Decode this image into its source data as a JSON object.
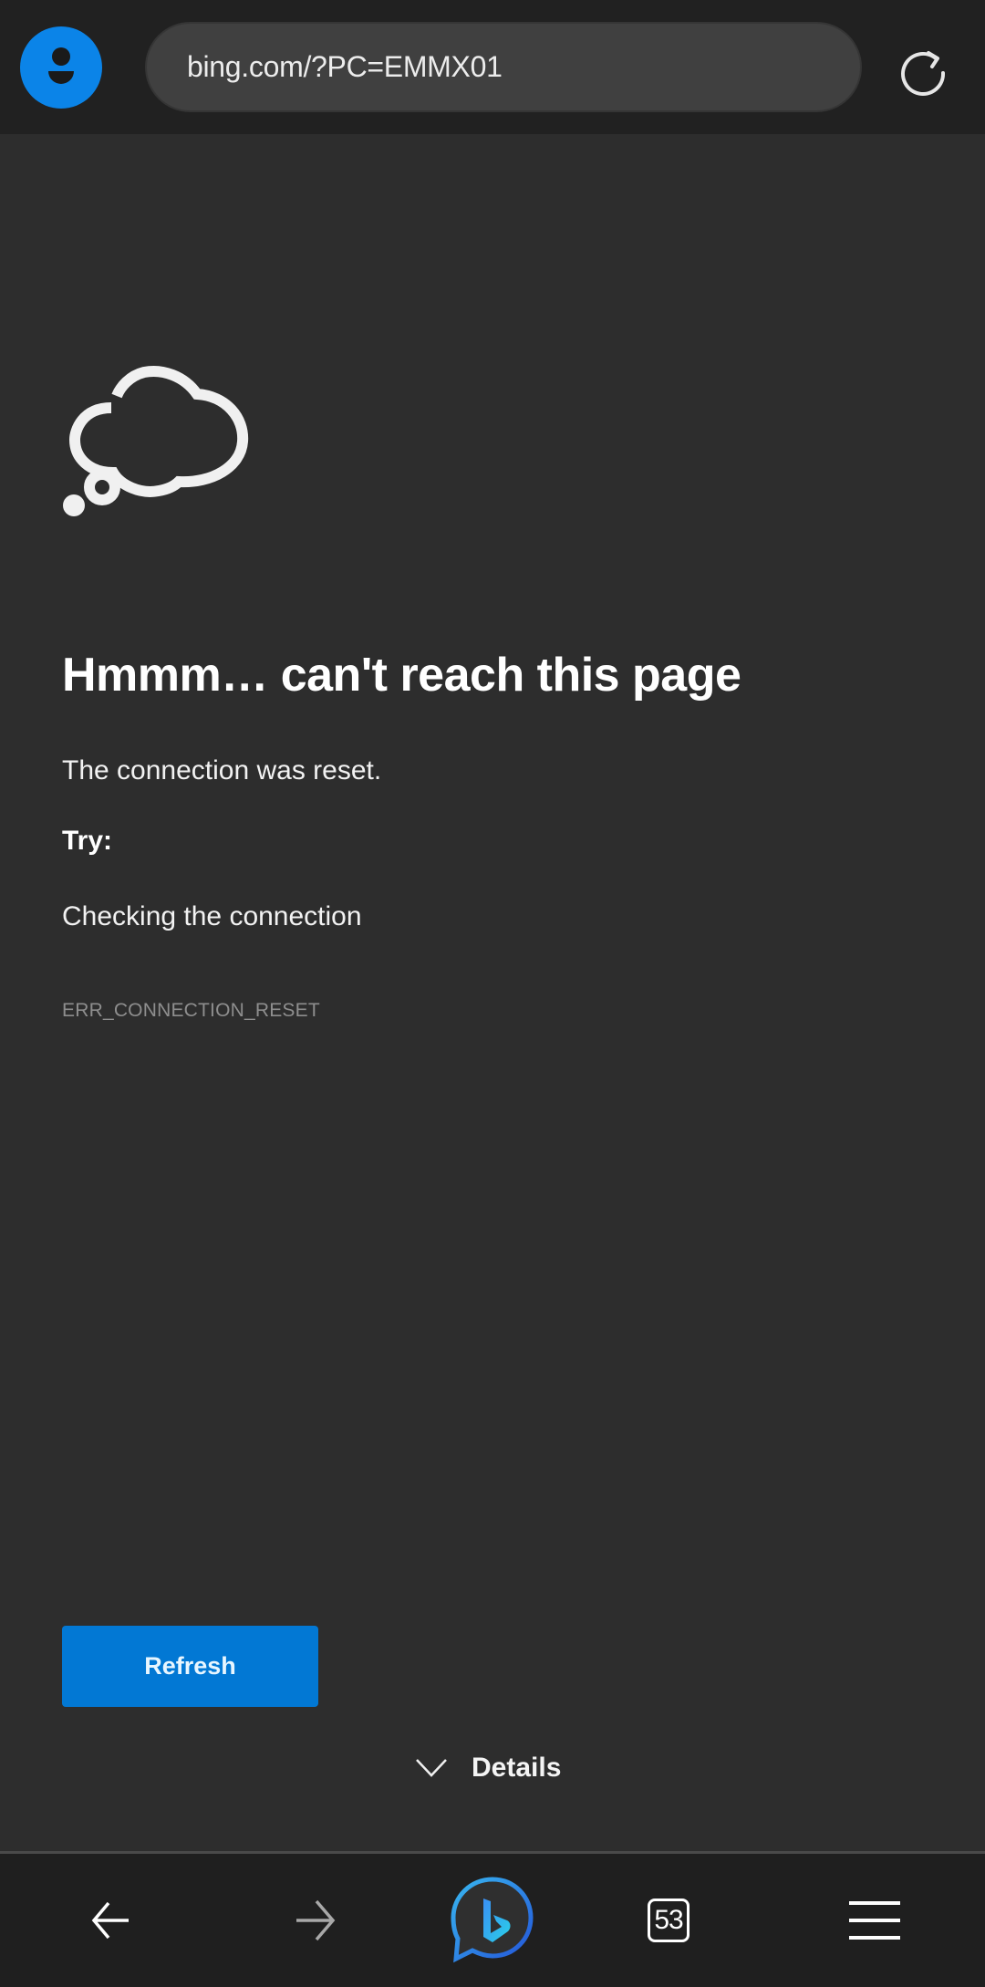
{
  "browser": {
    "url": "bing.com/?PC=EMMX01",
    "profile_icon": "person-icon",
    "reload_icon": "reload-icon",
    "accent_color": "#0b84e8"
  },
  "error_page": {
    "illustration": "thought-cloud-icon",
    "title": "Hmmm… can't reach this page",
    "message": "The connection was reset.",
    "try_label": "Try:",
    "suggestions": [
      "Checking the connection"
    ],
    "error_code": "ERR_CONNECTION_RESET",
    "refresh_label": "Refresh",
    "details_label": "Details",
    "refresh_color": "#0278d4"
  },
  "bottom_nav": {
    "back_icon": "arrow-left-icon",
    "forward_icon": "arrow-right-icon",
    "copilot_icon": "bing-chat-icon",
    "tab_count": "53",
    "menu_icon": "hamburger-menu-icon"
  }
}
